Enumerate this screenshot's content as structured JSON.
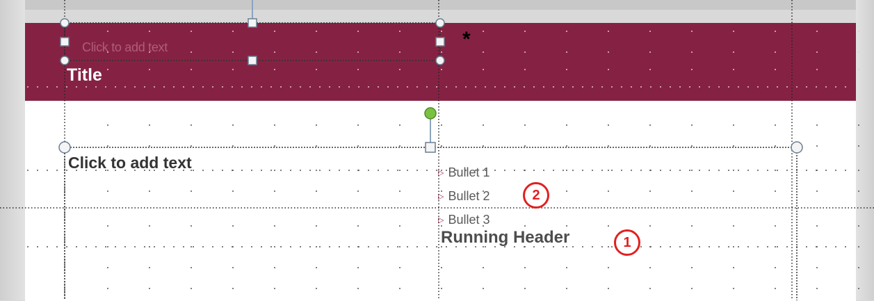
{
  "colors": {
    "title_band": "#852243",
    "frame": "#d9d9d9",
    "slide_bg": "#ffffff",
    "annotation_red": "#e02020",
    "rotation_handle": "#7ac142"
  },
  "header_placeholder": {
    "text": "Click to add text"
  },
  "title": {
    "text": "Title"
  },
  "marker": {
    "text": "*"
  },
  "body_placeholder": {
    "text": "Click to add text"
  },
  "bullets": [
    {
      "text": "Bullet 1"
    },
    {
      "text": "Bullet 2"
    },
    {
      "text": "Bullet 3"
    }
  ],
  "running_header": {
    "text": "Running Header"
  },
  "annotations": [
    {
      "text": "1"
    },
    {
      "text": "2"
    }
  ],
  "icons": {
    "bullet_marker": "triangle-bullet-icon",
    "rotation_handle": "rotation-handle-icon",
    "resize_handle": "resize-handle-icon"
  }
}
